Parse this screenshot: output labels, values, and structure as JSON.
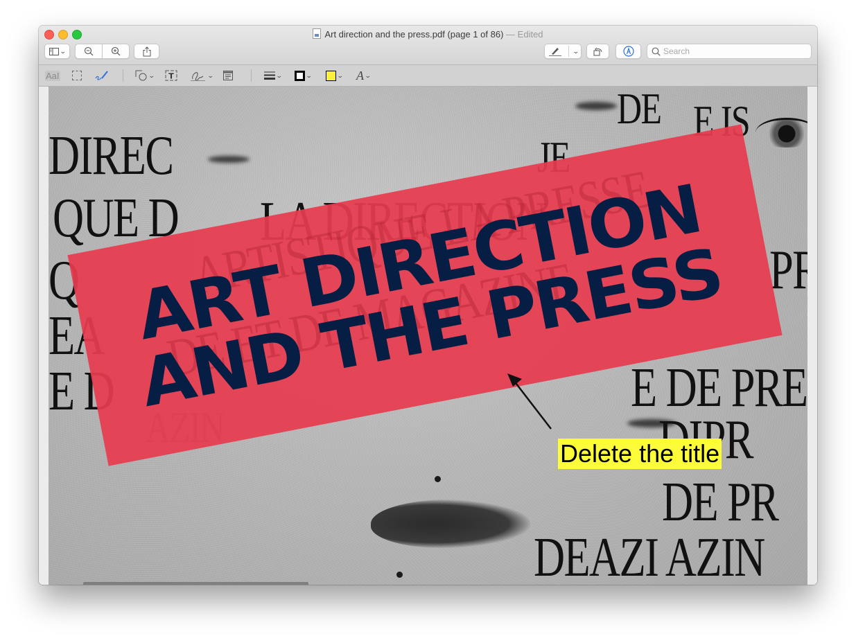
{
  "window": {
    "title": "Art direction and the press.pdf (page 1 of 86)",
    "title_separator": " — ",
    "edited_label": "Edited"
  },
  "toolbar": {
    "sidebar_button": "sidebar-toggle",
    "zoom_out": "zoom-out",
    "zoom_in": "zoom-in",
    "share": "share",
    "highlight": "highlight",
    "rotate": "rotate",
    "markup": "markup",
    "search": {
      "placeholder": "Search",
      "value": ""
    }
  },
  "markup_toolbar": {
    "items": [
      "text-selection",
      "rectangular-selection",
      "sketch",
      "shapes",
      "text-box",
      "sign",
      "note",
      "shape-style",
      "border-color",
      "fill-color",
      "text-style"
    ],
    "colors": {
      "border": "#000000",
      "fill": "#f8f03c",
      "sketch": "#2f6fd8"
    }
  },
  "document": {
    "headline_line1": "ART DIRECTION",
    "headline_line2": "AND THE PRESS",
    "banner_color": "#e43f50",
    "headline_color": "#061d44",
    "background_words": [
      "DIREC",
      "QUE D",
      "LA DIRECTION",
      "ARTISTIQUE",
      "LA PRESSE",
      "PRI",
      "DE ET DE MAGAZINE",
      "DE DE",
      "AZIN",
      "DE",
      "E IS",
      "JE",
      "E DE PRE",
      "DIPR",
      "DE PR",
      "DEAZI AZIN",
      "EA",
      "Q",
      "E D"
    ],
    "annotation": {
      "text": "Delete the title",
      "background": "#fdfc3a"
    }
  }
}
